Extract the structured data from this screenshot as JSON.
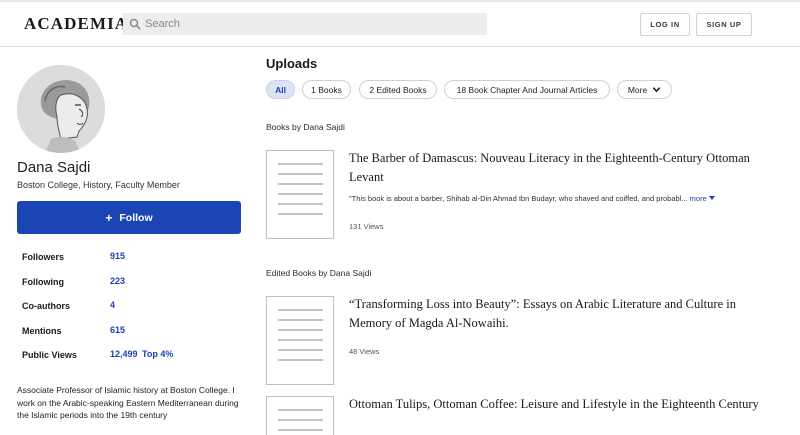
{
  "header": {
    "logo": "ACADEMIA",
    "search_placeholder": "Search",
    "login_label": "LOG IN",
    "signup_label": "SIGN UP"
  },
  "profile": {
    "name": "Dana Sajdi",
    "affiliation": "Boston College, History, Faculty Member",
    "follow_label": "Follow",
    "stats": [
      {
        "label": "Followers",
        "value": "915",
        "extra": ""
      },
      {
        "label": "Following",
        "value": "223",
        "extra": ""
      },
      {
        "label": "Co-authors",
        "value": "4",
        "extra": ""
      },
      {
        "label": "Mentions",
        "value": "615",
        "extra": ""
      },
      {
        "label": "Public Views",
        "value": "12,499",
        "extra": "Top 4%"
      }
    ],
    "bio": "Associate Professor of Islamic history at Boston College. I work on the Arabic-speaking Eastern Mediterranean during the Islamic periods into the 19th century"
  },
  "uploads": {
    "title": "Uploads",
    "tabs": [
      {
        "label": "All"
      },
      {
        "label": "1 Books"
      },
      {
        "label": "2 Edited Books"
      },
      {
        "label": "18 Book Chapter And Journal Articles"
      },
      {
        "label": "More"
      }
    ],
    "sections": [
      {
        "label": "Books by Dana Sajdi",
        "items": [
          {
            "title": "The Barber of Damascus: Nouveau Literacy in the Eighteenth-Century Ottoman Levant",
            "excerpt": "\"This book is about a barber, Shihab al-Din Ahmad Ibn Budayr, who shaved and coiffed, and probabl...",
            "more": "more",
            "views": "131 Views"
          }
        ]
      },
      {
        "label": "Edited Books by Dana Sajdi",
        "items": [
          {
            "title": "“Transforming Loss into Beauty”: Essays on Arabic Literature and Culture in Memory of Magda Al-Nowaihi.",
            "views": "48 Views"
          },
          {
            "title": "Ottoman Tulips, Ottoman Coffee: Leisure and Lifestyle in the Eighteenth Century"
          }
        ]
      }
    ]
  },
  "colors": {
    "accent": "#1b45b4",
    "pill_active_bg": "#dde3f3"
  }
}
